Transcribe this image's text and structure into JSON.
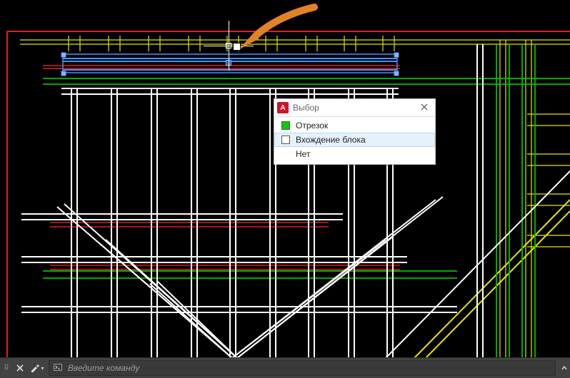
{
  "dialog": {
    "title": "Выбор",
    "items": [
      {
        "label": "Отрезок",
        "swatch": "green"
      },
      {
        "label": "Вхождение блока",
        "swatch": "white"
      },
      {
        "label": "Нет",
        "swatch": "none"
      }
    ]
  },
  "command_bar": {
    "placeholder": "Введите команду"
  },
  "app_icon_letter": "A"
}
